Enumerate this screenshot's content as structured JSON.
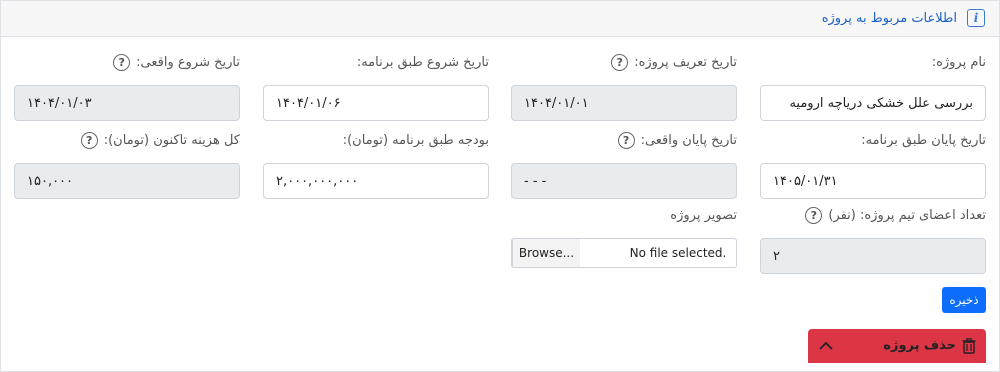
{
  "header": {
    "title": "اطلاعات مربوط به پروژه"
  },
  "fields": {
    "project_name": {
      "label": "نام پروژه:",
      "value": "بررسی علل  خشکی دریاچه ارومیه"
    },
    "definition_date": {
      "label": "تاریخ تعریف پروژه:",
      "value": "۱۴۰۴/۰۱/۰۱"
    },
    "planned_start": {
      "label": "تاریخ شروع طبق برنامه:",
      "value": "۱۴۰۴/۰۱/۰۶"
    },
    "actual_start": {
      "label": "تاریخ شروع واقعی:",
      "value": "۱۴۰۴/۰۱/۰۳"
    },
    "planned_end": {
      "label": "تاریخ پایان طبق برنامه:",
      "value": "۱۴۰۵/۰۱/۳۱"
    },
    "actual_end": {
      "label": "تاریخ پایان واقعی:",
      "value": "- - -"
    },
    "planned_budget": {
      "label": "بودجه طبق برنامه (تومان):",
      "value": "۲,۰۰۰,۰۰۰,۰۰۰"
    },
    "total_cost": {
      "label": "کل هزینه تاکنون (تومان):",
      "value": "۱۵۰,۰۰۰"
    },
    "team_count": {
      "label": "تعداد اعضای تیم پروژه: (نفر)",
      "value": "۲"
    },
    "project_image": {
      "label": "تصویر پروژه",
      "browse_label": "Browse...",
      "no_file_text": "No file selected."
    }
  },
  "help_icon_text": "?",
  "info_icon_text": "i",
  "buttons": {
    "save": "ذخیره",
    "delete": "حذف پروژه"
  },
  "colors": {
    "primary": "#0d6efd",
    "danger": "#dc3545",
    "readonly_bg": "#e9ecef"
  }
}
